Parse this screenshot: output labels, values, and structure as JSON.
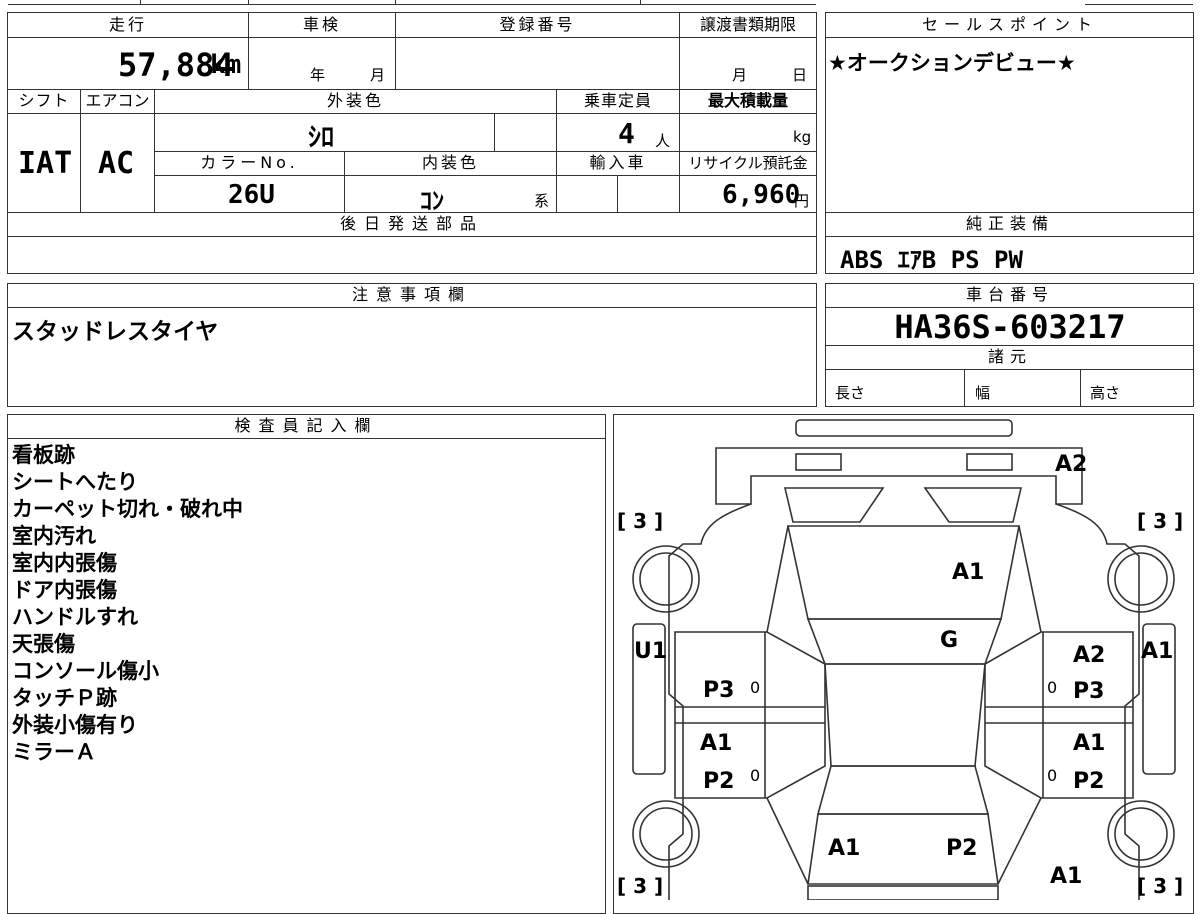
{
  "header": {
    "mileage_label": "走行",
    "inspection_label": "車検",
    "registration_label": "登録番号",
    "transfer_label": "譲渡書類期限",
    "sales_point_label": "セールスポイント"
  },
  "mileage": {
    "value": "57,884",
    "unit": "km"
  },
  "inspection": {
    "year": "年",
    "month": "月"
  },
  "transfer": {
    "month": "月",
    "day": "日"
  },
  "sales_point": {
    "text": "★オークションデビュー★"
  },
  "specs": {
    "shift_label": "シフト",
    "aircon_label": "エアコン",
    "exterior_label": "外装色",
    "capacity_label": "乗車定員",
    "max_load_label": "最大積載量",
    "shift_value": "IAT",
    "aircon_value": "AC",
    "exterior_value": "ｼﾛ",
    "capacity_value": "4",
    "capacity_unit": "人",
    "max_load_unit": "kg",
    "color_no_label": "カラーNo.",
    "interior_label": "内装色",
    "import_label": "輸入車",
    "recycle_label": "リサイクル預託金",
    "color_no_value": "26U",
    "interior_value": "ｺﾝ",
    "interior_suffix": "系",
    "recycle_value": "6,960",
    "recycle_unit": "円"
  },
  "later_parts": {
    "label": "後日発送部品"
  },
  "equipment": {
    "label": "純正装備",
    "value": "ABS ｴｱB PS PW"
  },
  "notes": {
    "label": "注意事項欄",
    "text": "スタッドレスタイヤ"
  },
  "chassis": {
    "label": "車台番号",
    "value": "HA36S-603217"
  },
  "dimensions": {
    "label": "諸元",
    "length": "長さ",
    "width": "幅",
    "height": "高さ"
  },
  "inspector": {
    "label": "検査員記入欄",
    "items": [
      "看板跡",
      "シートへたり",
      "カーペット切れ・破れ中",
      "室内汚れ",
      "室内内張傷",
      "ドア内張傷",
      "ハンドルすれ",
      "天張傷",
      "コンソール傷小",
      "タッチＰ跡",
      "外装小傷有り",
      "ミラーＡ"
    ]
  },
  "diagram": {
    "marks": {
      "front_bumper": "A2",
      "hood": "A1",
      "windshield": "G",
      "left_fender_front": "U1",
      "right_fender_front": "A1",
      "left_front_door": "P3",
      "left_rear_door_top": "A1",
      "left_rear_door": "P2",
      "right_front_door_top": "A2",
      "right_front_door": "P3",
      "right_rear_door_top": "A1",
      "right_rear_door": "P2",
      "rear_left": "A1",
      "rear_center": "P2",
      "rear_right": "A1"
    },
    "tire_brackets": {
      "front_left": "[ 3 ]",
      "front_right": "[ 3 ]",
      "rear_left": "[ 3 ]",
      "rear_right": "[ 3 ]"
    },
    "zeros": {
      "l1": "0",
      "l2": "0",
      "r1": "0",
      "r2": "0"
    }
  }
}
